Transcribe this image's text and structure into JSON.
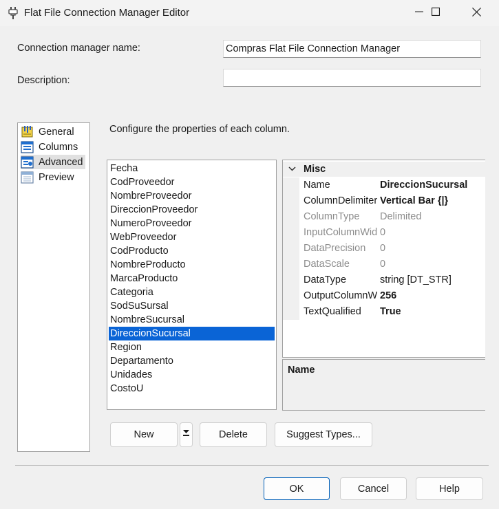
{
  "window": {
    "title": "Flat File Connection Manager Editor",
    "icon": "plug-icon",
    "controls": [
      "minimize-icon",
      "maximize-icon",
      "close-icon"
    ]
  },
  "form": {
    "name_label": "Connection manager name:",
    "name_value": "Compras Flat File Connection Manager",
    "description_label": "Description:",
    "description_value": ""
  },
  "nav": {
    "items": [
      {
        "label": "General",
        "icon": "general-icon"
      },
      {
        "label": "Columns",
        "icon": "columns-icon"
      },
      {
        "label": "Advanced",
        "icon": "advanced-icon",
        "selected": true
      },
      {
        "label": "Preview",
        "icon": "preview-icon"
      }
    ]
  },
  "instruction": "Configure the properties of each column.",
  "columns": {
    "items": [
      "Fecha",
      "CodProveedor",
      "NombreProveedor",
      "DireccionProveedor",
      "NumeroProveedor",
      "WebProveedor",
      "CodProducto",
      "NombreProducto",
      "MarcaProducto",
      "Categoria",
      "SodSuSursal",
      "NombreSucursal",
      "DireccionSucursal",
      "Region",
      "Departamento",
      "Unidades",
      "CostoU"
    ],
    "selected": "DireccionSucursal"
  },
  "properties": {
    "category": "Misc",
    "rows": [
      {
        "name": "Name",
        "value": "DireccionSucursal",
        "readonly": false,
        "bold": true
      },
      {
        "name": "ColumnDelimiter",
        "value": "Vertical Bar {|}",
        "readonly": false,
        "bold": true
      },
      {
        "name": "ColumnType",
        "value": "Delimited",
        "readonly": true,
        "bold": false
      },
      {
        "name": "InputColumnWidth",
        "value": "0",
        "readonly": true,
        "bold": false
      },
      {
        "name": "DataPrecision",
        "value": "0",
        "readonly": true,
        "bold": false
      },
      {
        "name": "DataScale",
        "value": "0",
        "readonly": true,
        "bold": false
      },
      {
        "name": "DataType",
        "value": "string [DT_STR]",
        "readonly": false,
        "bold": false
      },
      {
        "name": "OutputColumnWidth",
        "value": "256",
        "readonly": false,
        "bold": true
      },
      {
        "name": "TextQualified",
        "value": "True",
        "readonly": false,
        "bold": true
      }
    ],
    "description_title": "Name"
  },
  "buttons": {
    "new": "New",
    "delete": "Delete",
    "suggest": "Suggest Types...",
    "ok": "OK",
    "cancel": "Cancel",
    "help": "Help"
  },
  "colors": {
    "selection": "#0a64d6",
    "default_button_border": "#005fb8",
    "readonly_text": "#8c8c8c"
  }
}
